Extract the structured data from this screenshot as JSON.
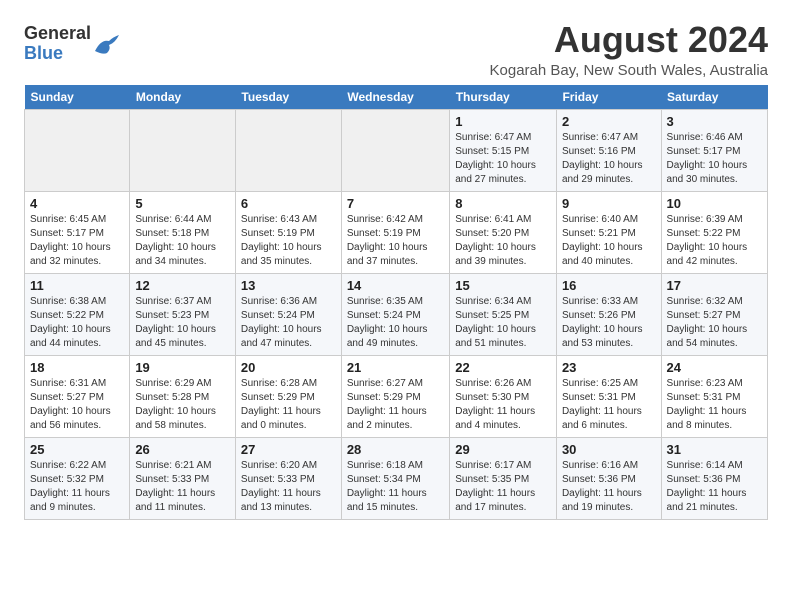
{
  "header": {
    "logo_general": "General",
    "logo_blue": "Blue",
    "title": "August 2024",
    "subtitle": "Kogarah Bay, New South Wales, Australia"
  },
  "days_of_week": [
    "Sunday",
    "Monday",
    "Tuesday",
    "Wednesday",
    "Thursday",
    "Friday",
    "Saturday"
  ],
  "weeks": [
    [
      {
        "day": "",
        "details": ""
      },
      {
        "day": "",
        "details": ""
      },
      {
        "day": "",
        "details": ""
      },
      {
        "day": "",
        "details": ""
      },
      {
        "day": "1",
        "details": "Sunrise: 6:47 AM\nSunset: 5:15 PM\nDaylight: 10 hours\nand 27 minutes."
      },
      {
        "day": "2",
        "details": "Sunrise: 6:47 AM\nSunset: 5:16 PM\nDaylight: 10 hours\nand 29 minutes."
      },
      {
        "day": "3",
        "details": "Sunrise: 6:46 AM\nSunset: 5:17 PM\nDaylight: 10 hours\nand 30 minutes."
      }
    ],
    [
      {
        "day": "4",
        "details": "Sunrise: 6:45 AM\nSunset: 5:17 PM\nDaylight: 10 hours\nand 32 minutes."
      },
      {
        "day": "5",
        "details": "Sunrise: 6:44 AM\nSunset: 5:18 PM\nDaylight: 10 hours\nand 34 minutes."
      },
      {
        "day": "6",
        "details": "Sunrise: 6:43 AM\nSunset: 5:19 PM\nDaylight: 10 hours\nand 35 minutes."
      },
      {
        "day": "7",
        "details": "Sunrise: 6:42 AM\nSunset: 5:19 PM\nDaylight: 10 hours\nand 37 minutes."
      },
      {
        "day": "8",
        "details": "Sunrise: 6:41 AM\nSunset: 5:20 PM\nDaylight: 10 hours\nand 39 minutes."
      },
      {
        "day": "9",
        "details": "Sunrise: 6:40 AM\nSunset: 5:21 PM\nDaylight: 10 hours\nand 40 minutes."
      },
      {
        "day": "10",
        "details": "Sunrise: 6:39 AM\nSunset: 5:22 PM\nDaylight: 10 hours\nand 42 minutes."
      }
    ],
    [
      {
        "day": "11",
        "details": "Sunrise: 6:38 AM\nSunset: 5:22 PM\nDaylight: 10 hours\nand 44 minutes."
      },
      {
        "day": "12",
        "details": "Sunrise: 6:37 AM\nSunset: 5:23 PM\nDaylight: 10 hours\nand 45 minutes."
      },
      {
        "day": "13",
        "details": "Sunrise: 6:36 AM\nSunset: 5:24 PM\nDaylight: 10 hours\nand 47 minutes."
      },
      {
        "day": "14",
        "details": "Sunrise: 6:35 AM\nSunset: 5:24 PM\nDaylight: 10 hours\nand 49 minutes."
      },
      {
        "day": "15",
        "details": "Sunrise: 6:34 AM\nSunset: 5:25 PM\nDaylight: 10 hours\nand 51 minutes."
      },
      {
        "day": "16",
        "details": "Sunrise: 6:33 AM\nSunset: 5:26 PM\nDaylight: 10 hours\nand 53 minutes."
      },
      {
        "day": "17",
        "details": "Sunrise: 6:32 AM\nSunset: 5:27 PM\nDaylight: 10 hours\nand 54 minutes."
      }
    ],
    [
      {
        "day": "18",
        "details": "Sunrise: 6:31 AM\nSunset: 5:27 PM\nDaylight: 10 hours\nand 56 minutes."
      },
      {
        "day": "19",
        "details": "Sunrise: 6:29 AM\nSunset: 5:28 PM\nDaylight: 10 hours\nand 58 minutes."
      },
      {
        "day": "20",
        "details": "Sunrise: 6:28 AM\nSunset: 5:29 PM\nDaylight: 11 hours\nand 0 minutes."
      },
      {
        "day": "21",
        "details": "Sunrise: 6:27 AM\nSunset: 5:29 PM\nDaylight: 11 hours\nand 2 minutes."
      },
      {
        "day": "22",
        "details": "Sunrise: 6:26 AM\nSunset: 5:30 PM\nDaylight: 11 hours\nand 4 minutes."
      },
      {
        "day": "23",
        "details": "Sunrise: 6:25 AM\nSunset: 5:31 PM\nDaylight: 11 hours\nand 6 minutes."
      },
      {
        "day": "24",
        "details": "Sunrise: 6:23 AM\nSunset: 5:31 PM\nDaylight: 11 hours\nand 8 minutes."
      }
    ],
    [
      {
        "day": "25",
        "details": "Sunrise: 6:22 AM\nSunset: 5:32 PM\nDaylight: 11 hours\nand 9 minutes."
      },
      {
        "day": "26",
        "details": "Sunrise: 6:21 AM\nSunset: 5:33 PM\nDaylight: 11 hours\nand 11 minutes."
      },
      {
        "day": "27",
        "details": "Sunrise: 6:20 AM\nSunset: 5:33 PM\nDaylight: 11 hours\nand 13 minutes."
      },
      {
        "day": "28",
        "details": "Sunrise: 6:18 AM\nSunset: 5:34 PM\nDaylight: 11 hours\nand 15 minutes."
      },
      {
        "day": "29",
        "details": "Sunrise: 6:17 AM\nSunset: 5:35 PM\nDaylight: 11 hours\nand 17 minutes."
      },
      {
        "day": "30",
        "details": "Sunrise: 6:16 AM\nSunset: 5:36 PM\nDaylight: 11 hours\nand 19 minutes."
      },
      {
        "day": "31",
        "details": "Sunrise: 6:14 AM\nSunset: 5:36 PM\nDaylight: 11 hours\nand 21 minutes."
      }
    ]
  ]
}
